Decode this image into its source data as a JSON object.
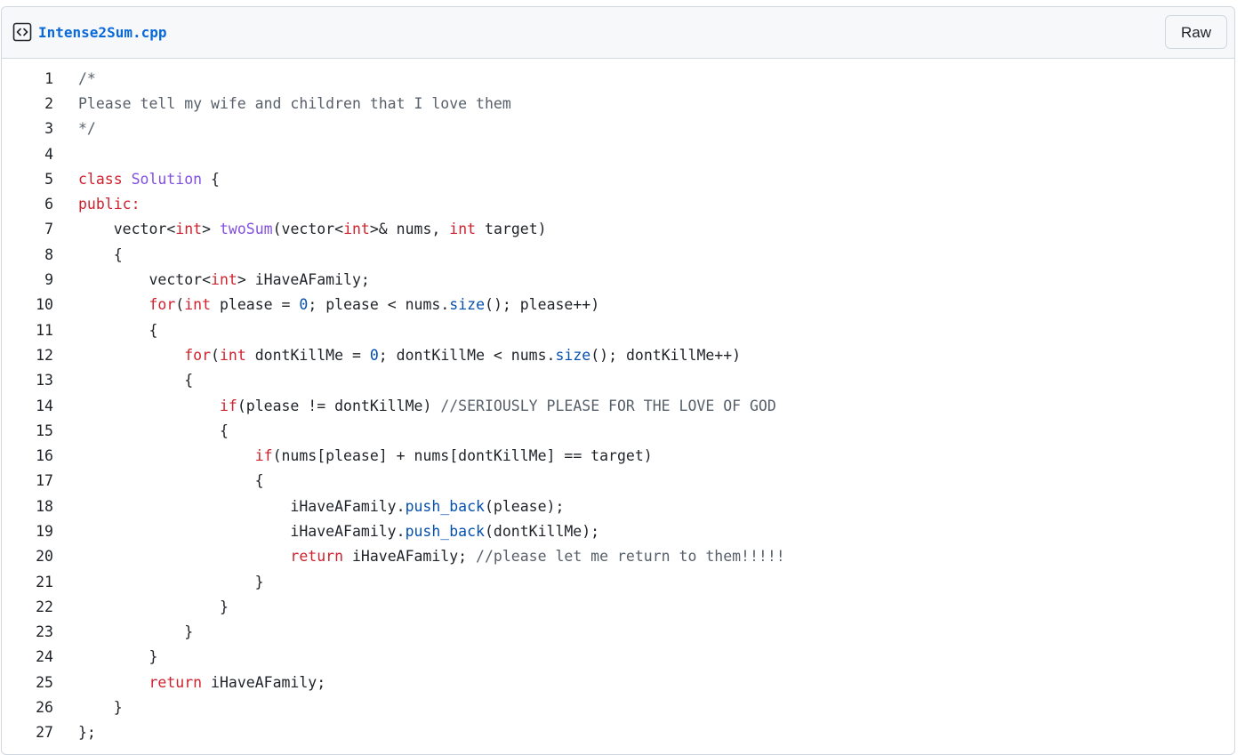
{
  "file": {
    "name": "Intense2Sum.cpp",
    "raw_label": "Raw",
    "icon": "code-file-icon"
  },
  "colors": {
    "keyword": "#cf222e",
    "comment": "#57606a",
    "entity": "#8250df",
    "constant": "#0550ae",
    "text": "#1f2328",
    "link": "#0969da"
  },
  "code_lines": [
    {
      "num": "1",
      "tokens": [
        [
          "comment",
          "/*"
        ]
      ]
    },
    {
      "num": "2",
      "tokens": [
        [
          "comment",
          "Please tell my wife and children that I love them"
        ]
      ]
    },
    {
      "num": "3",
      "tokens": [
        [
          "comment",
          "*/"
        ]
      ]
    },
    {
      "num": "4",
      "tokens": []
    },
    {
      "num": "5",
      "tokens": [
        [
          "keyword",
          "class"
        ],
        [
          "plain",
          " "
        ],
        [
          "entity",
          "Solution"
        ],
        [
          "plain",
          " {"
        ]
      ]
    },
    {
      "num": "6",
      "tokens": [
        [
          "keyword",
          "public:"
        ]
      ]
    },
    {
      "num": "7",
      "tokens": [
        [
          "plain",
          "    vector<"
        ],
        [
          "keyword",
          "int"
        ],
        [
          "plain",
          "> "
        ],
        [
          "entity",
          "twoSum"
        ],
        [
          "plain",
          "(vector<"
        ],
        [
          "keyword",
          "int"
        ],
        [
          "plain",
          ">& nums, "
        ],
        [
          "keyword",
          "int"
        ],
        [
          "plain",
          " target)"
        ]
      ]
    },
    {
      "num": "8",
      "tokens": [
        [
          "plain",
          "    {"
        ]
      ]
    },
    {
      "num": "9",
      "tokens": [
        [
          "plain",
          "        vector<"
        ],
        [
          "keyword",
          "int"
        ],
        [
          "plain",
          "> iHaveAFamily;"
        ]
      ]
    },
    {
      "num": "10",
      "tokens": [
        [
          "plain",
          "        "
        ],
        [
          "keyword",
          "for"
        ],
        [
          "plain",
          "("
        ],
        [
          "keyword",
          "int"
        ],
        [
          "plain",
          " please = "
        ],
        [
          "constant",
          "0"
        ],
        [
          "plain",
          "; please < nums."
        ],
        [
          "constant",
          "size"
        ],
        [
          "plain",
          "(); please++)"
        ]
      ]
    },
    {
      "num": "11",
      "tokens": [
        [
          "plain",
          "        {"
        ]
      ]
    },
    {
      "num": "12",
      "tokens": [
        [
          "plain",
          "            "
        ],
        [
          "keyword",
          "for"
        ],
        [
          "plain",
          "("
        ],
        [
          "keyword",
          "int"
        ],
        [
          "plain",
          " dontKillMe = "
        ],
        [
          "constant",
          "0"
        ],
        [
          "plain",
          "; dontKillMe < nums."
        ],
        [
          "constant",
          "size"
        ],
        [
          "plain",
          "(); dontKillMe++)"
        ]
      ]
    },
    {
      "num": "13",
      "tokens": [
        [
          "plain",
          "            {"
        ]
      ]
    },
    {
      "num": "14",
      "tokens": [
        [
          "plain",
          "                "
        ],
        [
          "keyword",
          "if"
        ],
        [
          "plain",
          "(please != dontKillMe) "
        ],
        [
          "comment",
          "//SERIOUSLY PLEASE FOR THE LOVE OF GOD"
        ]
      ]
    },
    {
      "num": "15",
      "tokens": [
        [
          "plain",
          "                {"
        ]
      ]
    },
    {
      "num": "16",
      "tokens": [
        [
          "plain",
          "                    "
        ],
        [
          "keyword",
          "if"
        ],
        [
          "plain",
          "(nums[please] + nums[dontKillMe] == target)"
        ]
      ]
    },
    {
      "num": "17",
      "tokens": [
        [
          "plain",
          "                    {"
        ]
      ]
    },
    {
      "num": "18",
      "tokens": [
        [
          "plain",
          "                        iHaveAFamily."
        ],
        [
          "constant",
          "push_back"
        ],
        [
          "plain",
          "(please);"
        ]
      ]
    },
    {
      "num": "19",
      "tokens": [
        [
          "plain",
          "                        iHaveAFamily."
        ],
        [
          "constant",
          "push_back"
        ],
        [
          "plain",
          "(dontKillMe);"
        ]
      ]
    },
    {
      "num": "20",
      "tokens": [
        [
          "plain",
          "                        "
        ],
        [
          "keyword",
          "return"
        ],
        [
          "plain",
          " iHaveAFamily; "
        ],
        [
          "comment",
          "//please let me return to them!!!!!"
        ]
      ]
    },
    {
      "num": "21",
      "tokens": [
        [
          "plain",
          "                    }"
        ]
      ]
    },
    {
      "num": "22",
      "tokens": [
        [
          "plain",
          "                }"
        ]
      ]
    },
    {
      "num": "23",
      "tokens": [
        [
          "plain",
          "            }"
        ]
      ]
    },
    {
      "num": "24",
      "tokens": [
        [
          "plain",
          "        }"
        ]
      ]
    },
    {
      "num": "25",
      "tokens": [
        [
          "plain",
          "        "
        ],
        [
          "keyword",
          "return"
        ],
        [
          "plain",
          " iHaveAFamily;"
        ]
      ]
    },
    {
      "num": "26",
      "tokens": [
        [
          "plain",
          "    }"
        ]
      ]
    },
    {
      "num": "27",
      "tokens": [
        [
          "plain",
          "};"
        ]
      ]
    }
  ]
}
